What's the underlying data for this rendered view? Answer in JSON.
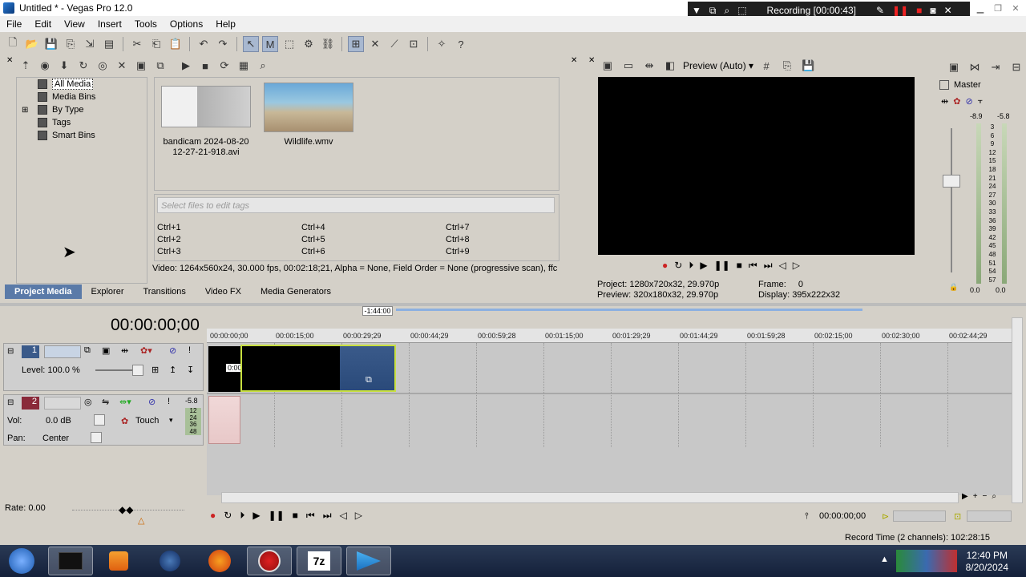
{
  "window": {
    "title": "Untitled * - Vegas Pro 12.0"
  },
  "recording": {
    "label": "Recording [00:00:43]"
  },
  "menu": [
    "File",
    "Edit",
    "View",
    "Insert",
    "Tools",
    "Options",
    "Help"
  ],
  "media_tree": [
    "All Media",
    "Media Bins",
    "By Type",
    "Tags",
    "Smart Bins"
  ],
  "media_files": [
    {
      "name": "bandicam 2024-08-20 12-27-21-918.avi"
    },
    {
      "name": "Wildlife.wmv"
    }
  ],
  "tags": {
    "placeholder": "Select files to edit tags",
    "shortcuts": [
      "Ctrl+1",
      "Ctrl+4",
      "Ctrl+7",
      "Ctrl+2",
      "Ctrl+5",
      "Ctrl+8",
      "Ctrl+3",
      "Ctrl+6",
      "Ctrl+9"
    ]
  },
  "media_info": "Video: 1264x560x24, 30.000 fps, 00:02:18;21, Alpha = None, Field Order = None (progressive scan), ffc",
  "tabs": [
    "Project Media",
    "Explorer",
    "Transitions",
    "Video FX",
    "Media Generators"
  ],
  "preview": {
    "mode": "Preview (Auto)",
    "project_label": "Project:",
    "project_value": "1280x720x32, 29.970p",
    "preview_label": "Preview:",
    "preview_value": "320x180x32, 29.970p",
    "frame_label": "Frame:",
    "frame_value": "0",
    "display_label": "Display:",
    "display_value": "395x222x32"
  },
  "mixer": {
    "title": "Master",
    "peak_left": "-8.9",
    "peak_right": "-5.8",
    "scale": [
      "3",
      "6",
      "9",
      "12",
      "15",
      "18",
      "21",
      "24",
      "27",
      "30",
      "33",
      "36",
      "39",
      "42",
      "45",
      "48",
      "51",
      "54",
      "57"
    ],
    "bottom_left": "0.0",
    "bottom_right": "0.0"
  },
  "timeline": {
    "timecode": "00:00:00;00",
    "region_label": "-1:44:00",
    "ruler": [
      "00:00:00;00",
      "00:00:15;00",
      "00:00:29;29",
      "00:00:44;29",
      "00:00:59;28",
      "00:01:15;00",
      "00:01:29;29",
      "00:01:44;29",
      "00:01:59;28",
      "00:02:15;00",
      "00:02:30;00",
      "00:02:44;29"
    ],
    "track1": {
      "number": "1",
      "level_label": "Level: 100.0 %"
    },
    "track2": {
      "number": "2",
      "vol_label": "Vol:",
      "vol_value": "0.0 dB",
      "automation": "Touch",
      "pan_label": "Pan:",
      "pan_value": "Center",
      "peak": "-5.8",
      "meter_scale": [
        "12",
        "24",
        "36",
        "48"
      ]
    },
    "clip_time": "0:00",
    "rate_label": "Rate: 0.00",
    "cursor_time": "00:00:00;00"
  },
  "status": {
    "record_time": "Record Time (2 channels): 102:28:15"
  },
  "clock": {
    "time": "12:40 PM",
    "date": "8/20/2024"
  }
}
